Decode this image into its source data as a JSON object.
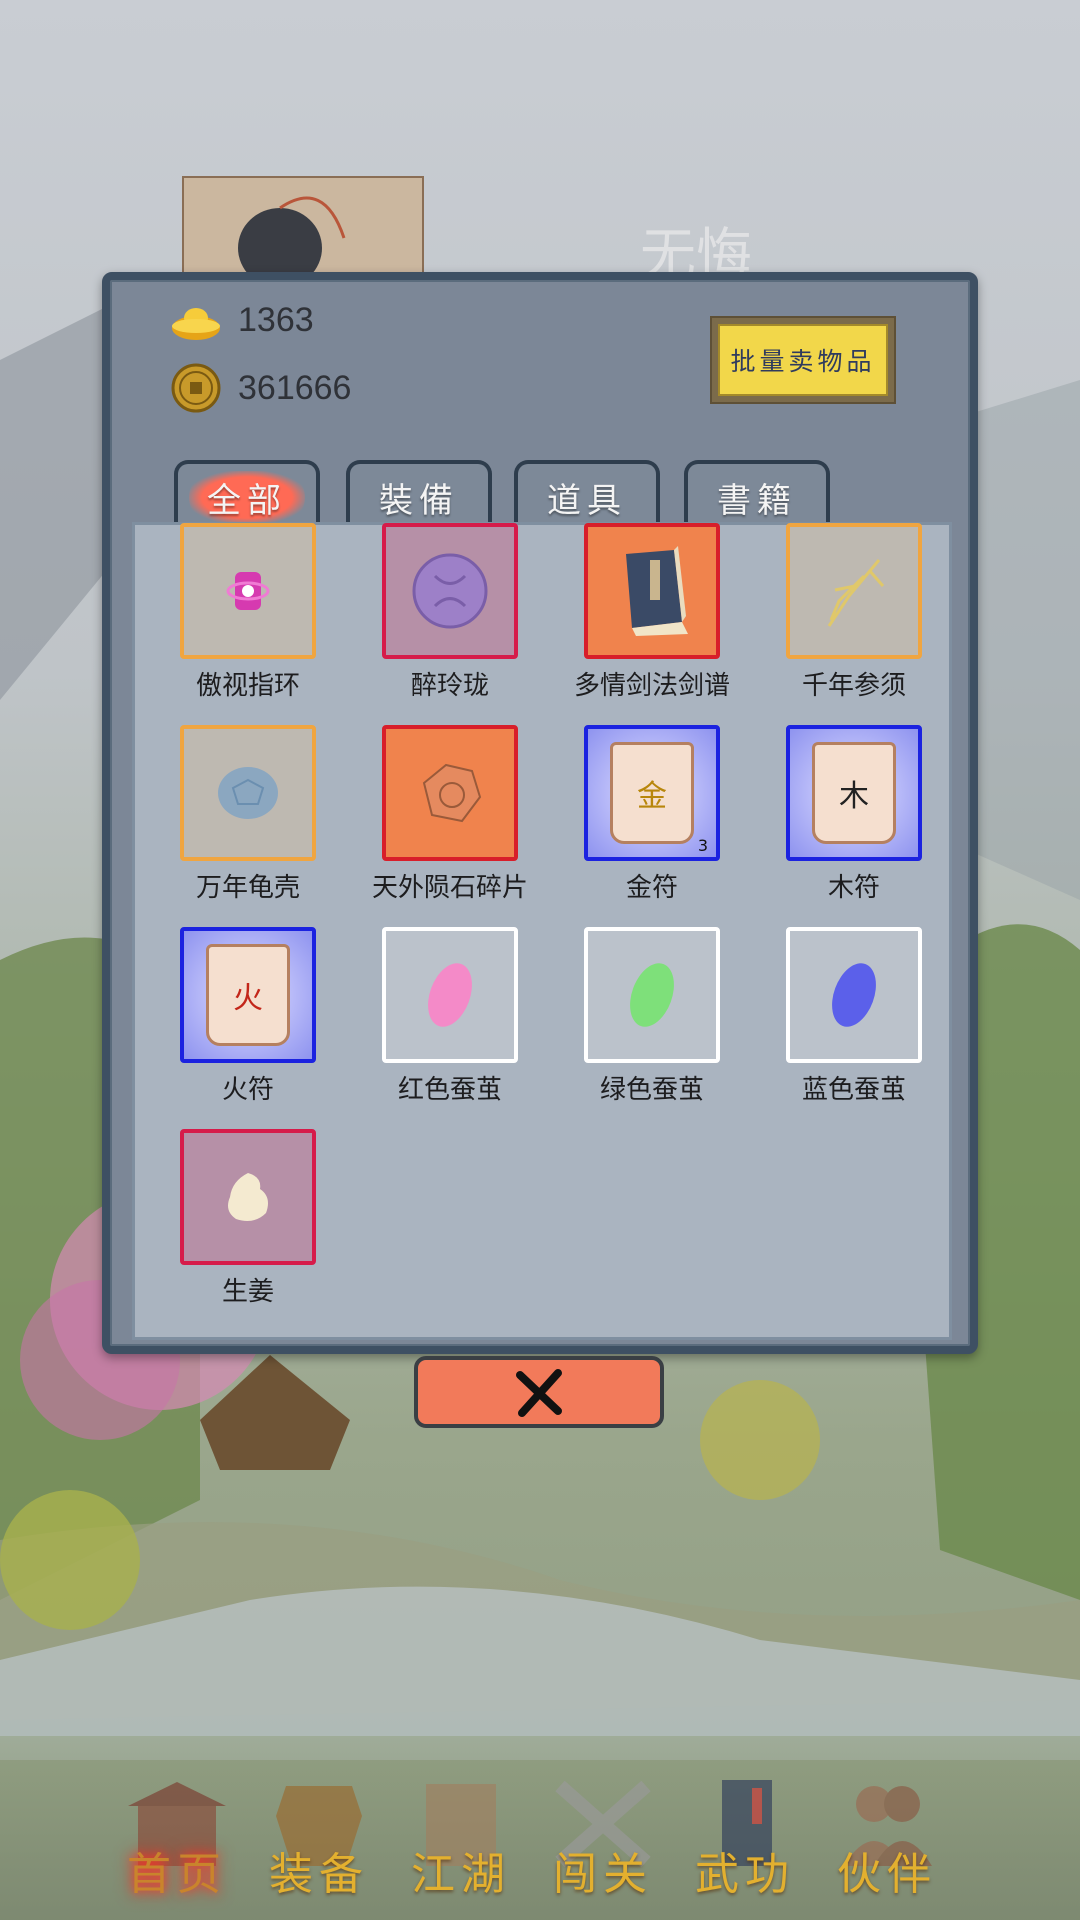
{
  "background": {
    "title": "无悔"
  },
  "currency": {
    "gold_ingots": "1363",
    "coins": "361666"
  },
  "batch_sell_label": "批量卖物品",
  "tabs": [
    {
      "label": "全部",
      "active": true
    },
    {
      "label": "裝備",
      "active": false
    },
    {
      "label": "道具",
      "active": false
    },
    {
      "label": "書籍",
      "active": false
    }
  ],
  "items": [
    {
      "name": "傲视指环",
      "quality": "orange",
      "icon": "ring-icon"
    },
    {
      "name": "醉玲珑",
      "quality": "red",
      "icon": "jade-disc-icon"
    },
    {
      "name": "多情剑法剑谱",
      "quality": "red-bold",
      "icon": "book-icon"
    },
    {
      "name": "千年参须",
      "quality": "orange",
      "icon": "ginseng-icon"
    },
    {
      "name": "万年龟壳",
      "quality": "orange",
      "icon": "turtle-shell-icon"
    },
    {
      "name": "天外陨石碎片",
      "quality": "red-bold",
      "icon": "meteorite-icon"
    },
    {
      "name": "金符",
      "quality": "blue",
      "icon": "talisman-icon",
      "glyph": "金",
      "count": "3"
    },
    {
      "name": "木符",
      "quality": "blue",
      "icon": "talisman-icon",
      "glyph": "木"
    },
    {
      "name": "火符",
      "quality": "blue",
      "icon": "talisman-icon",
      "glyph": "火"
    },
    {
      "name": "红色蚕茧",
      "quality": "white",
      "icon": "cocoon-icon",
      "color": "#f48ac8"
    },
    {
      "name": "绿色蚕茧",
      "quality": "white",
      "icon": "cocoon-icon",
      "color": "#7ee07a"
    },
    {
      "name": "蓝色蚕茧",
      "quality": "white",
      "icon": "cocoon-icon",
      "color": "#5b60ea"
    },
    {
      "name": "生姜",
      "quality": "red",
      "icon": "ginger-icon"
    }
  ],
  "nav": [
    {
      "label": "首页",
      "icon": "home-icon",
      "active": true
    },
    {
      "label": "装备",
      "icon": "armor-icon",
      "active": false
    },
    {
      "label": "江湖",
      "icon": "scroll-icon",
      "active": false
    },
    {
      "label": "闯关",
      "icon": "crossed-swords-icon",
      "active": false
    },
    {
      "label": "武功",
      "icon": "manual-icon",
      "active": false
    },
    {
      "label": "伙伴",
      "icon": "companions-icon",
      "active": false
    }
  ]
}
